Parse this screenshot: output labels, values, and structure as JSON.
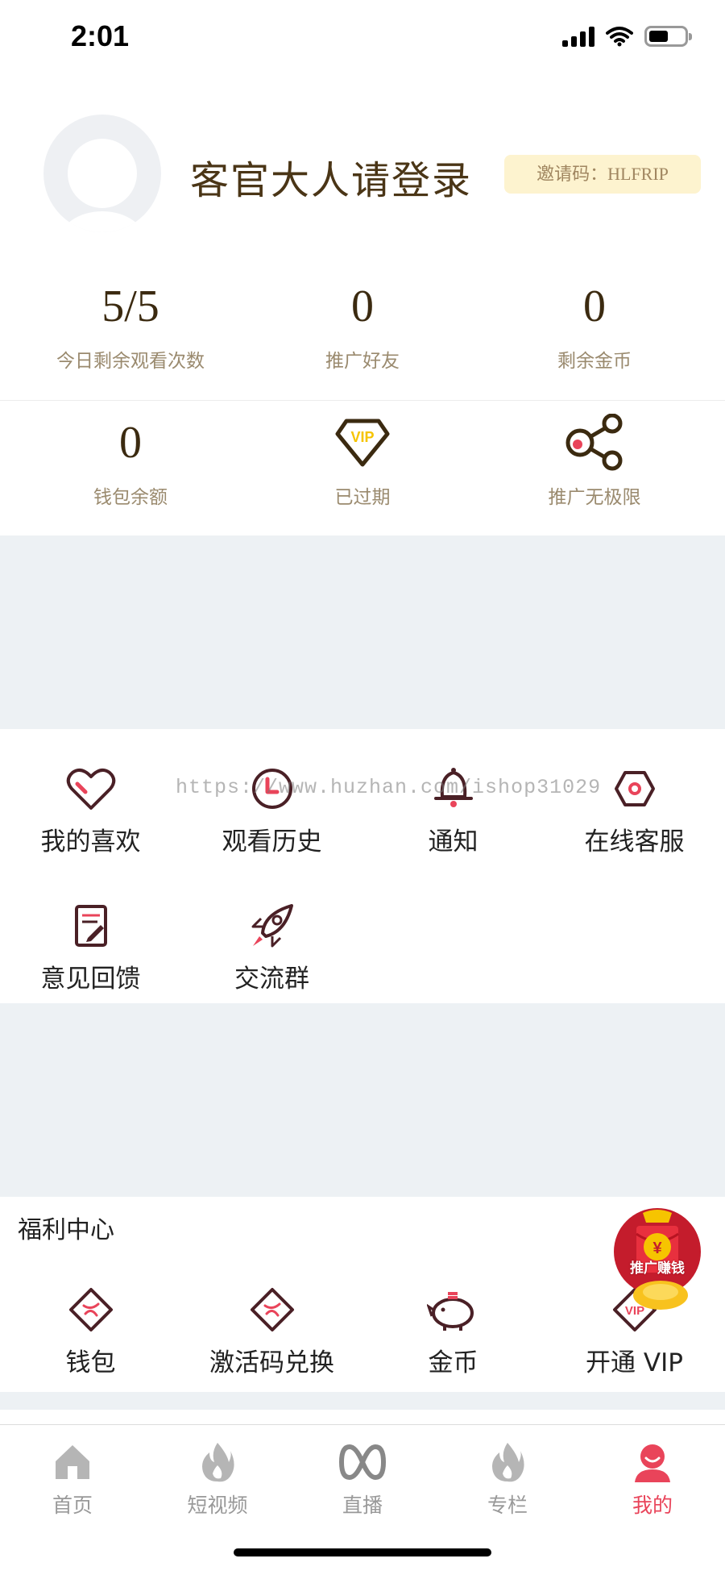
{
  "status_bar": {
    "time": "2:01",
    "battery_level": 0.55
  },
  "profile": {
    "login_prompt": "客官大人请登录",
    "invite_code": "邀请码：HLFRIP"
  },
  "stats": [
    {
      "value": "5/5",
      "label": "今日剩余观看次数"
    },
    {
      "value": "0",
      "label": "推广好友"
    },
    {
      "value": "0",
      "label": "剩余金币"
    }
  ],
  "stats2": [
    {
      "value": "0",
      "label": "钱包余额"
    },
    {
      "icon": "vip-badge-icon",
      "icon_text": "VIP",
      "label": "已过期"
    },
    {
      "icon": "share-icon",
      "label": "推广无极限"
    }
  ],
  "menu": [
    {
      "icon": "heart-icon",
      "label": "我的喜欢"
    },
    {
      "icon": "clock-icon",
      "label": "观看历史"
    },
    {
      "icon": "bell-icon",
      "label": "通知"
    },
    {
      "icon": "hexagon-icon",
      "label": "在线客服"
    },
    {
      "icon": "feedback-icon",
      "label": "意见回馈"
    },
    {
      "icon": "rocket-icon",
      "label": "交流群"
    }
  ],
  "watermark": "https://www.huzhan.com/ishop31029",
  "welfare": {
    "title": "福利中心",
    "items": [
      {
        "icon": "wallet-icon",
        "label": "钱包"
      },
      {
        "icon": "activation-code-icon",
        "label": "激活码兑换"
      },
      {
        "icon": "piggy-bank-icon",
        "label": "金币"
      },
      {
        "icon": "vip-diamond-icon",
        "label": "开通 VIP",
        "icon_text": "VIP"
      }
    ],
    "promo_badge": "推广赚钱",
    "promo_symbol": "¥"
  },
  "tabs": [
    {
      "icon": "home-icon",
      "label": "首页"
    },
    {
      "icon": "flame-icon",
      "label": "短视频"
    },
    {
      "icon": "live-icon",
      "label": "直播"
    },
    {
      "icon": "flame-icon",
      "label": "专栏"
    },
    {
      "icon": "user-icon",
      "label": "我的",
      "active": true
    }
  ],
  "colors": {
    "accent": "#e9445a",
    "brown": "#4a3516",
    "gold": "#f6c400",
    "band": "#edf1f4"
  }
}
